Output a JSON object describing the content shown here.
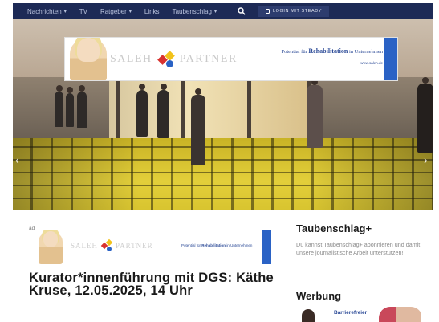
{
  "nav": {
    "items": [
      {
        "label": "Nachrichten",
        "dropdown": true
      },
      {
        "label": "TV",
        "dropdown": false
      },
      {
        "label": "Ratgeber",
        "dropdown": true
      },
      {
        "label": "Links",
        "dropdown": false
      },
      {
        "label": "Taubenschlag",
        "dropdown": true
      }
    ],
    "search_icon": "search-icon",
    "login_label": "LOGIN MIT STEADY",
    "login_icon": "steady-icon"
  },
  "hero": {
    "ad": {
      "brand_left": "SALEH",
      "brand_right": "PARTNER",
      "claim_prefix": "Potential für",
      "claim_bold": "Rehabilitation",
      "claim_suffix": "in Unternehmen",
      "url": "www.saleh.de"
    },
    "prev_icon": "chevron-left-icon",
    "next_icon": "chevron-right-icon"
  },
  "article": {
    "kicker": "ad",
    "ad": {
      "brand_left": "SALEH",
      "brand_right": "PARTNER",
      "claim_prefix": "Potential für",
      "claim_bold": "Rehabilitation",
      "claim_suffix": "in Unternehmen"
    },
    "headline": "Kurator*innenführung mit DGS: Käthe Kruse, 12.05.2025, 14 Uhr"
  },
  "sidebar": {
    "taubenschlag_title": "Taubenschlag+",
    "taubenschlag_text": "Du kannst Taubenschlag+ abonnieren und damit unsere journalistische Arbeit unterstützen!",
    "werbung_title": "Werbung",
    "werbung_ad_text": "Barrierefreier"
  },
  "colors": {
    "nav_bg": "#1d2a56",
    "brand_blue": "#2a62c5",
    "floor_yellow": "#e3cf3a"
  }
}
